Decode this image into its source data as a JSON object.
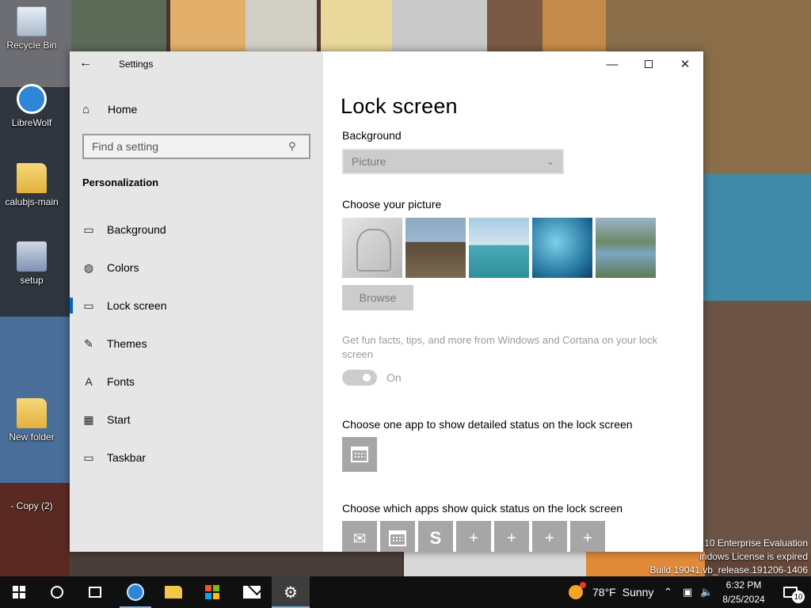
{
  "desktop": {
    "icons": [
      {
        "label": "Recycle Bin"
      },
      {
        "label": "LibreWolf"
      },
      {
        "label": "calubjs-main"
      },
      {
        "label": "setup"
      },
      {
        "label": "New folder"
      },
      {
        "label": "- Copy (2)"
      }
    ],
    "watermark": {
      "line1": "s 10 Enterprise Evaluation",
      "line2": "indows License is expired",
      "line3": "Build 19041.vb_release.191206-1406"
    }
  },
  "window": {
    "title": "Settings",
    "controls": {
      "minimize": "—",
      "close": "✕"
    }
  },
  "sidebar": {
    "home_label": "Home",
    "search_placeholder": "Find a setting",
    "section_title": "Personalization",
    "items": [
      {
        "label": "Background",
        "icon": "image-icon",
        "glyph": "▭"
      },
      {
        "label": "Colors",
        "icon": "palette-icon",
        "glyph": "◍"
      },
      {
        "label": "Lock screen",
        "icon": "lock-screen-icon",
        "glyph": "▭",
        "active": true
      },
      {
        "label": "Themes",
        "icon": "brush-icon",
        "glyph": "✎"
      },
      {
        "label": "Fonts",
        "icon": "font-icon",
        "glyph": "A"
      },
      {
        "label": "Start",
        "icon": "start-icon",
        "glyph": "▦"
      },
      {
        "label": "Taskbar",
        "icon": "taskbar-icon",
        "glyph": "▭"
      }
    ]
  },
  "main": {
    "page_title": "Lock screen",
    "background_label": "Background",
    "background_value": "Picture",
    "choose_picture_label": "Choose your picture",
    "browse_label": "Browse",
    "fun_facts_text": "Get fun facts, tips, and more from Windows and Cortana on your lock screen",
    "toggle_state": "On",
    "detailed_status_label": "Choose one app to show detailed status on the lock screen",
    "quick_status_label": "Choose which apps show quick status on the lock screen",
    "quick_status_tiles": [
      "mail-icon",
      "calendar-icon",
      "skype-icon",
      "add-icon",
      "add-icon",
      "add-icon",
      "add-icon"
    ]
  },
  "taskbar": {
    "weather_temp": "78°F",
    "weather_cond": "Sunny",
    "time": "6:32 PM",
    "date": "8/25/2024",
    "notification_count": "10"
  },
  "colors": {
    "accent": "#0067c0",
    "sidebar_bg": "#e6e6e6",
    "taskbar_bg": "#101010"
  }
}
